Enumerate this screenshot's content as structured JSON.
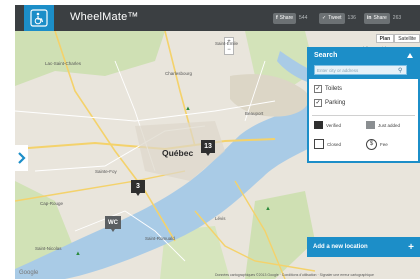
{
  "app": {
    "brand": "WheelMate™",
    "logo_icon": "wheelchair-icon",
    "accent_color": "#1c8ec8"
  },
  "share": [
    {
      "label": "Share",
      "count": "544",
      "icon": "facebook-icon"
    },
    {
      "label": "Tweet",
      "count": "136",
      "icon": "twitter-icon"
    },
    {
      "label": "Share",
      "count": "263",
      "icon": "linkedin-icon"
    }
  ],
  "map": {
    "map_type_options": [
      "Plan",
      "Satellite"
    ],
    "city_label": "Québec",
    "place_labels": [
      "Saint-Émile",
      "Charlesbourg",
      "Lac-Saint-Charles",
      "Sainte-Foy",
      "Lévis",
      "Saint-Romuald",
      "Beauport",
      "Château-Richer",
      "Saint-Nicolas",
      "Cap-Rouge"
    ],
    "markers": [
      {
        "kind": "cluster",
        "count": "13"
      },
      {
        "kind": "cluster",
        "count": "3"
      },
      {
        "kind": "wc",
        "label": "WC"
      }
    ],
    "attribution": "Données cartographiques ©2013 Google · Conditions d'utilisation · Signaler une erreur cartographique",
    "google_label": "Google"
  },
  "panel": {
    "title": "Search",
    "search_placeholder": "Enter city or address",
    "filters": [
      {
        "label": "Toilets",
        "checked": true
      },
      {
        "label": "Parking",
        "checked": true
      }
    ],
    "legend": [
      {
        "label": "Verified",
        "icon": "verified-marker-icon"
      },
      {
        "label": "Just added",
        "icon": "just-added-marker-icon"
      },
      {
        "label": "Closed",
        "icon": "closed-icon"
      },
      {
        "label": "Fee",
        "icon": "fee-dollar-icon"
      }
    ]
  },
  "add_location": {
    "label": "Add a new location",
    "icon": "plus-icon"
  }
}
